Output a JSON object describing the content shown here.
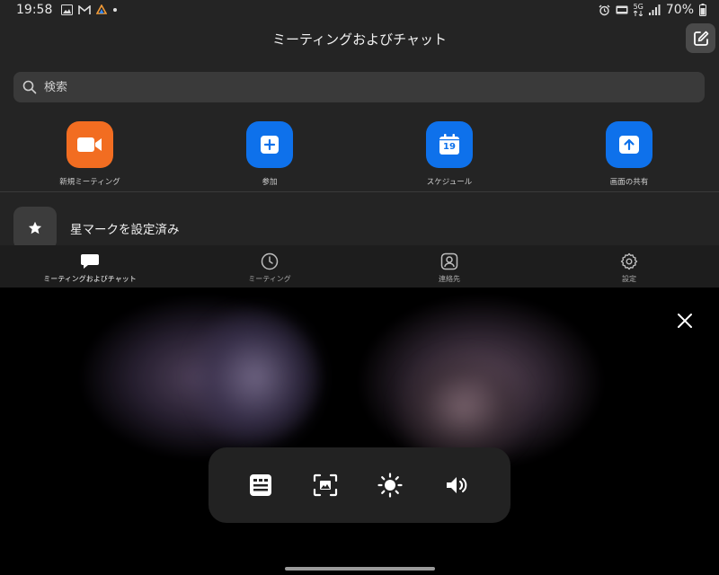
{
  "status_bar": {
    "time": "19:58",
    "battery": "70%",
    "network": "5G",
    "left_icons": [
      "gallery-icon",
      "gmail-icon",
      "app-icon",
      "dot-icon"
    ],
    "right_icons": [
      "alarm-icon",
      "volte-icon",
      "5g-icon",
      "signal-icon",
      "battery-icon"
    ]
  },
  "header": {
    "title": "ミーティングおよびチャット",
    "compose_icon": "compose-icon"
  },
  "search": {
    "placeholder": "検索"
  },
  "actions": [
    {
      "label": "新規ミーティング",
      "icon": "video-camera-icon",
      "color": "#F26D21"
    },
    {
      "label": "参加",
      "icon": "plus-icon",
      "color": "#0E71EB"
    },
    {
      "label": "スケジュール",
      "icon": "calendar-icon",
      "calendar_day": "19",
      "color": "#0E71EB"
    },
    {
      "label": "画面の共有",
      "icon": "share-up-arrow-icon",
      "color": "#0E71EB"
    }
  ],
  "starred": {
    "label": "星マークを設定済み",
    "icon": "star-icon"
  },
  "tabs": [
    {
      "label": "ミーティングおよびチャット",
      "icon": "chat-bubble-icon",
      "active": true
    },
    {
      "label": "ミーティング",
      "icon": "clock-icon",
      "active": false
    },
    {
      "label": "連絡先",
      "icon": "contact-icon",
      "active": false
    },
    {
      "label": "設定",
      "icon": "gear-icon",
      "active": false
    }
  ],
  "viewer": {
    "close_icon": "close-icon",
    "controls": [
      {
        "icon": "caption-icon"
      },
      {
        "icon": "screenshot-icon"
      },
      {
        "icon": "brightness-icon"
      },
      {
        "icon": "volume-icon"
      }
    ]
  },
  "colors": {
    "app_bg": "#242424",
    "accent_orange": "#F26D21",
    "accent_blue": "#0E71EB"
  }
}
